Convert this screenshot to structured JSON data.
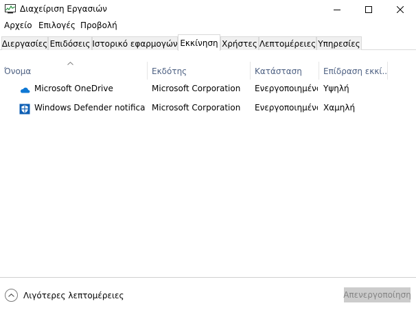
{
  "window": {
    "title": "Διαχείριση Εργασιών",
    "icon": "task-manager-icon"
  },
  "menu": [
    "Αρχείο",
    "Επιλογές",
    "Προβολή"
  ],
  "tabs": [
    {
      "label": "Διεργασίες",
      "active": false
    },
    {
      "label": "Επιδόσεις",
      "active": false
    },
    {
      "label": "Ιστορικό εφαρμογών",
      "active": false
    },
    {
      "label": "Εκκίνηση",
      "active": true
    },
    {
      "label": "Χρήστες",
      "active": false
    },
    {
      "label": "Λεπτομέρειες",
      "active": false
    },
    {
      "label": "Υπηρεσίες",
      "active": false
    }
  ],
  "columns": [
    "Όνομα",
    "Εκδότης",
    "Κατάσταση",
    "Επίδραση εκκί..."
  ],
  "sort": {
    "column": "Όνομα",
    "direction": "ascending"
  },
  "rows": [
    {
      "name": "Microsoft OneDrive",
      "publisher": "Microsoft Corporation",
      "status": "Ενεργοποιημένο",
      "impact": "Υψηλή",
      "icon": "onedrive-icon",
      "icon_color": "#0f78d4"
    },
    {
      "name": "Windows Defender notificati...",
      "publisher": "Microsoft Corporation",
      "status": "Ενεργοποιημένο",
      "impact": "Χαμηλή",
      "icon": "defender-shield-icon",
      "icon_color": "#0f5fb4"
    }
  ],
  "footer": {
    "fewer_details_label": "Λιγότερες λεπτομέρειες",
    "disable_button_label": "Απενεργοποίηση",
    "disable_button_enabled": false
  },
  "colors": {
    "column_header_text": "#4d6082",
    "disabled_button_bg": "#cccccc",
    "disabled_button_text": "#838383"
  }
}
